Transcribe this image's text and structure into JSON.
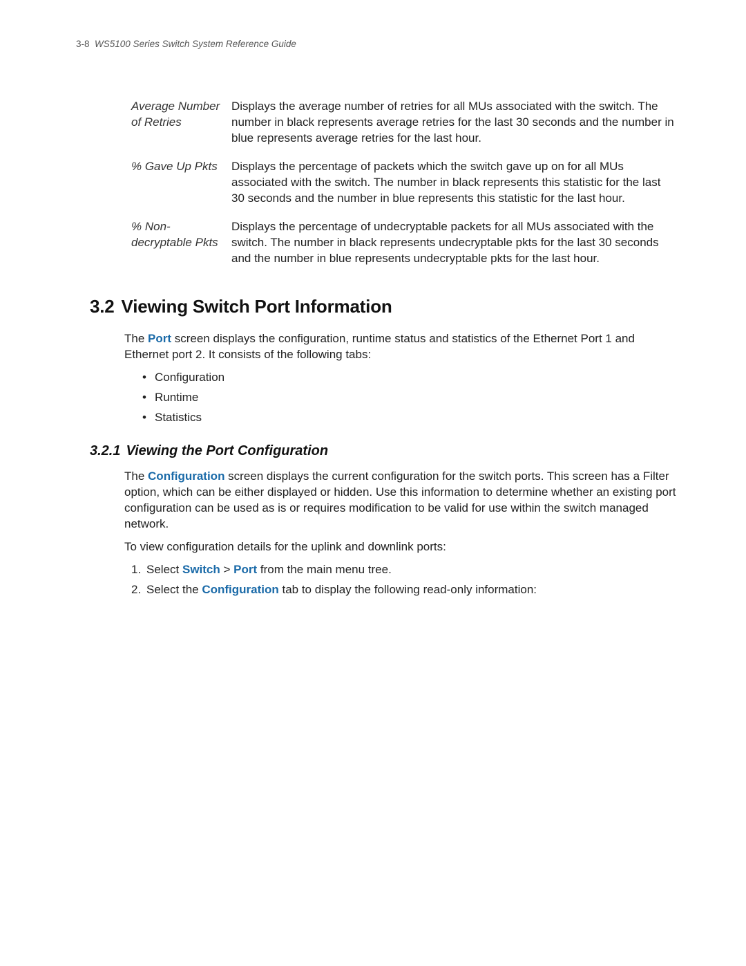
{
  "header": {
    "page_num": "3-8",
    "doc_title": "WS5100 Series Switch System Reference Guide"
  },
  "definitions": [
    {
      "term": "Average Number of Retries",
      "desc": "Displays the average number of retries for all MUs associated with the switch. The number in black represents average retries for the last 30 seconds and the number in blue represents average retries for the last hour."
    },
    {
      "term": "% Gave Up Pkts",
      "desc": "Displays the percentage of packets which the switch gave up on for all MUs associated with the switch. The number in black represents this statistic for the last 30 seconds and the number in blue represents this statistic for the last hour."
    },
    {
      "term": "% Non-decryptable Pkts",
      "desc": "Displays the percentage of undecryptable packets for all MUs associated with the switch. The number in black represents undecryptable pkts for the last 30 seconds and the number in blue represents undecryptable pkts for the last hour."
    }
  ],
  "section": {
    "number": "3.2",
    "title": "Viewing Switch Port Information",
    "intro_pre": "The ",
    "intro_link": "Port",
    "intro_post": " screen displays the configuration, runtime status and statistics of the Ethernet Port 1 and Ethernet port 2. It consists of the following tabs:",
    "tabs": [
      "Configuration",
      "Runtime",
      "Statistics"
    ]
  },
  "subsection": {
    "number": "3.2.1",
    "title": "Viewing the Port Configuration",
    "para1_pre": "The ",
    "para1_link": "Configuration",
    "para1_post": " screen displays the current configuration for the switch ports. This screen has a Filter option, which can be either displayed or hidden. Use this information to determine whether an existing port configuration can be used as is or requires modification to be valid for use within the switch managed network.",
    "para2": "To view configuration details for the uplink and downlink ports:",
    "steps": {
      "s1_pre": "Select ",
      "s1_link1": "Switch",
      "s1_mid": " > ",
      "s1_link2": "Port",
      "s1_post": " from the main menu tree.",
      "s2_pre": "Select the ",
      "s2_link": "Configuration",
      "s2_post": " tab to display the following read-only information:"
    }
  }
}
